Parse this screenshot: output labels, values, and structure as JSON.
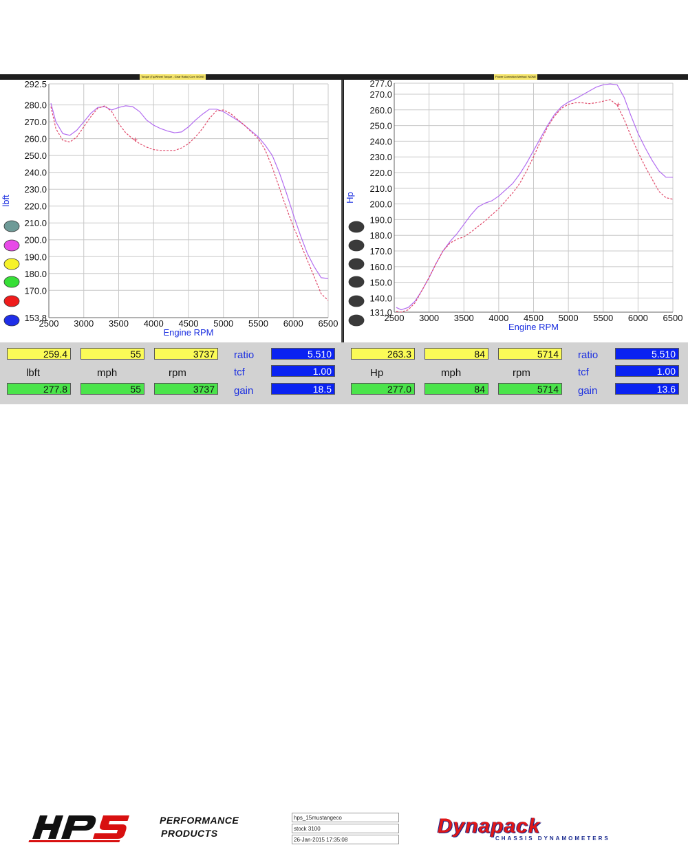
{
  "colors": {
    "measured": "#b26cf0",
    "baseline": "#e04a6a",
    "grid": "#c8c8c8",
    "axis_text": "#111111",
    "axis_label": "#1a2ee0"
  },
  "header": {
    "left": "Torque (Tq/Wheel Torque - Gear Ratio)   Corr: NONE",
    "right": "Power    Correction Method: NONE"
  },
  "chart_data": [
    {
      "type": "line",
      "xlabel": "Engine RPM",
      "ylabel": "lbft",
      "xlim": [
        2500,
        6500
      ],
      "ylim": [
        153.8,
        292.5
      ],
      "x_ticks": [
        "2500",
        "3000",
        "3500",
        "4000",
        "4500",
        "5000",
        "5500",
        "6000",
        "6500"
      ],
      "y_ticks": [
        "292.5",
        "280.0",
        "270.0",
        "260.0",
        "250.0",
        "240.0",
        "230.0",
        "220.0",
        "210.0",
        "200.0",
        "190.0",
        "180.0",
        "170.0",
        "153.8"
      ],
      "grid": true,
      "series": [
        {
          "style": "solid",
          "color": "#b26cf0",
          "x": [
            2530,
            2600,
            2700,
            2800,
            2900,
            3000,
            3100,
            3200,
            3300,
            3400,
            3500,
            3600,
            3700,
            3800,
            3900,
            4000,
            4100,
            4200,
            4300,
            4400,
            4500,
            4600,
            4700,
            4800,
            4900,
            5000,
            5100,
            5200,
            5300,
            5400,
            5500,
            5600,
            5700,
            5800,
            5900,
            6000,
            6100,
            6200,
            6300,
            6400,
            6500
          ],
          "y": [
            281,
            270,
            263,
            262,
            265,
            270,
            275,
            278.5,
            279,
            277,
            278.5,
            279.5,
            279,
            276,
            271,
            268,
            266,
            264.5,
            263.5,
            264,
            267,
            271,
            274.5,
            277.5,
            277.5,
            276,
            273.5,
            271,
            268,
            264.5,
            261,
            256,
            250,
            240,
            228,
            215,
            203,
            192,
            184,
            177.5,
            177
          ]
        },
        {
          "style": "dashed",
          "color": "#e04a6a",
          "x": [
            2530,
            2600,
            2700,
            2800,
            2900,
            3000,
            3100,
            3200,
            3300,
            3400,
            3500,
            3600,
            3700,
            3800,
            3900,
            4000,
            4100,
            4200,
            4300,
            4400,
            4500,
            4600,
            4700,
            4800,
            4900,
            5000,
            5100,
            5200,
            5300,
            5400,
            5500,
            5600,
            5700,
            5800,
            5900,
            6000,
            6100,
            6200,
            6300,
            6400,
            6500
          ],
          "y": [
            279,
            266,
            259,
            258,
            261,
            267,
            273,
            278,
            279.5,
            276,
            269,
            263.5,
            260,
            257,
            255,
            253.5,
            253,
            253,
            253,
            254.5,
            257,
            261,
            266,
            272,
            276.5,
            277,
            275,
            271.5,
            268,
            264,
            260,
            253,
            243,
            231,
            219,
            208,
            198,
            188,
            178,
            168,
            164
          ]
        }
      ],
      "cursor": {
        "x": 3737,
        "y": 259.4
      }
    },
    {
      "type": "line",
      "xlabel": "Engine RPM",
      "ylabel": "Hp",
      "xlim": [
        2500,
        6500
      ],
      "ylim": [
        131.0,
        277.0
      ],
      "x_ticks": [
        "2500",
        "3000",
        "3500",
        "4000",
        "4500",
        "5000",
        "5500",
        "6000",
        "6500"
      ],
      "y_ticks": [
        "277.0",
        "270.0",
        "260.0",
        "250.0",
        "240.0",
        "230.0",
        "220.0",
        "210.0",
        "200.0",
        "190.0",
        "180.0",
        "170.0",
        "160.0",
        "150.0",
        "140.0",
        "131.0"
      ],
      "grid": true,
      "series": [
        {
          "style": "solid",
          "color": "#b26cf0",
          "x": [
            2530,
            2600,
            2700,
            2800,
            2900,
            3000,
            3100,
            3200,
            3300,
            3400,
            3500,
            3600,
            3700,
            3800,
            3900,
            4000,
            4100,
            4200,
            4300,
            4400,
            4500,
            4600,
            4700,
            4800,
            4900,
            5000,
            5100,
            5200,
            5300,
            5400,
            5500,
            5600,
            5700,
            5800,
            5900,
            6000,
            6100,
            6200,
            6300,
            6400,
            6500
          ],
          "y": [
            134,
            132.5,
            134,
            138,
            145,
            153,
            162,
            170,
            176,
            181,
            187,
            193,
            198,
            200.5,
            202,
            205,
            209,
            213,
            219,
            226,
            234,
            242,
            250,
            257,
            262,
            265,
            267,
            269.5,
            272,
            274.5,
            276,
            276.5,
            276,
            268,
            256,
            245,
            236,
            228,
            221,
            217,
            217
          ]
        },
        {
          "style": "dashed",
          "color": "#e04a6a",
          "x": [
            2530,
            2600,
            2700,
            2800,
            2900,
            3000,
            3100,
            3200,
            3300,
            3400,
            3500,
            3600,
            3700,
            3800,
            3900,
            4000,
            4100,
            4200,
            4300,
            4400,
            4500,
            4600,
            4700,
            4800,
            4900,
            5000,
            5100,
            5200,
            5300,
            5400,
            5500,
            5600,
            5700,
            5800,
            5900,
            6000,
            6100,
            6200,
            6300,
            6400,
            6500
          ],
          "y": [
            131.5,
            131,
            132.5,
            137,
            145,
            153,
            162,
            170,
            175,
            177.5,
            179,
            182,
            185.5,
            189,
            193,
            197,
            202,
            207,
            213,
            221,
            230,
            240,
            249,
            256,
            261,
            263.5,
            264.5,
            264.5,
            264,
            264.5,
            265.5,
            266.5,
            263,
            254,
            243,
            233,
            224,
            216,
            208,
            204,
            203
          ]
        }
      ],
      "cursor": {
        "x": 5714,
        "y": 263.3
      }
    }
  ],
  "legend_left": [
    "#6e9a97",
    "#e84ae8",
    "#f6f22a",
    "#37df37",
    "#ef1c1c",
    "#1f2ee8"
  ],
  "legend_right": [
    "#3a3a3a",
    "#3a3a3a",
    "#3a3a3a",
    "#3a3a3a",
    "#3a3a3a",
    "#3a3a3a"
  ],
  "readouts": {
    "left": {
      "row1": [
        "259.4",
        "55",
        "3737"
      ],
      "labels": [
        "lbft",
        "mph",
        "rpm"
      ],
      "row2": [
        "277.8",
        "55",
        "3737"
      ],
      "side_labels": [
        "ratio",
        "tcf",
        "gain"
      ],
      "side_values": [
        "5.510",
        "1.00",
        "18.5"
      ]
    },
    "right": {
      "row1": [
        "263.3",
        "84",
        "5714"
      ],
      "labels": [
        "Hp",
        "mph",
        "rpm"
      ],
      "row2": [
        "277.0",
        "84",
        "5714"
      ],
      "side_labels": [
        "ratio",
        "tcf",
        "gain"
      ],
      "side_values": [
        "5.510",
        "1.00",
        "13.6"
      ]
    }
  },
  "footer": {
    "hps_logo": "HPS",
    "hps_line1": "PERFORMANCE",
    "hps_line2": "PRODUCTS",
    "info": [
      "hps_15mustangeco",
      "stock          3100",
      "26-Jan-2015   17:35:08"
    ],
    "dynapack": "Dynapack",
    "dynapack_sub": "CHASSIS DYNAMOMETERS"
  }
}
